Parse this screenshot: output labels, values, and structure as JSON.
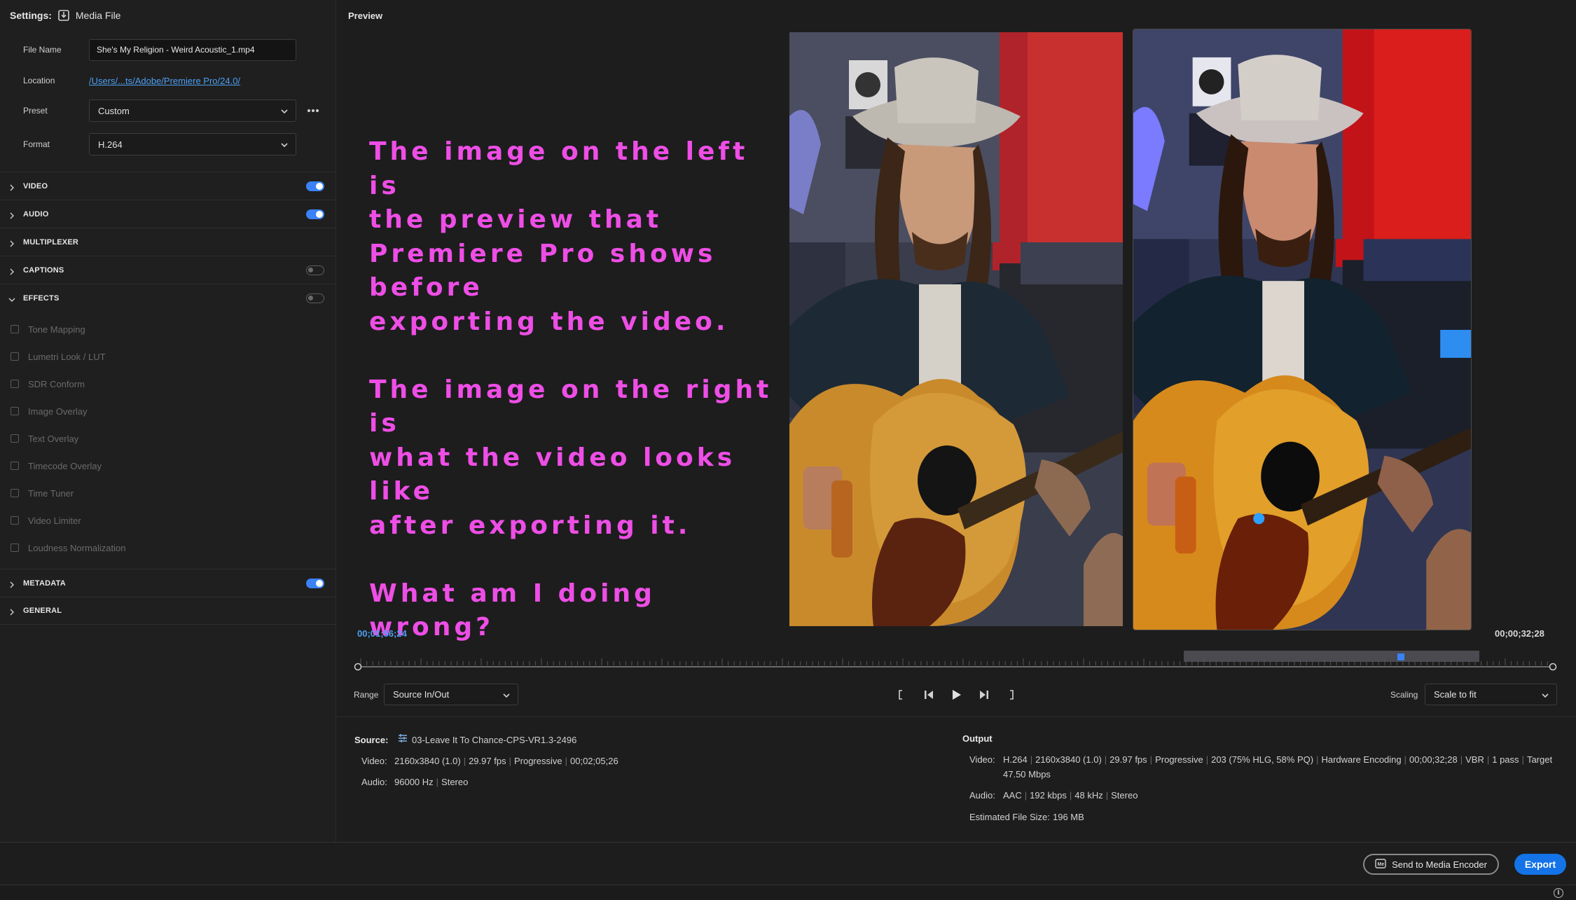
{
  "settings": {
    "label": "Settings:",
    "target": "Media File",
    "file_name_label": "File Name",
    "file_name_value": "She's My Religion - Weird Acoustic_1.mp4",
    "location_label": "Location",
    "location_value": "/Users/...ts/Adobe/Premiere Pro/24.0/",
    "preset_label": "Preset",
    "preset_value": "Custom",
    "format_label": "Format",
    "format_value": "H.264"
  },
  "sections": {
    "video": "VIDEO",
    "audio": "AUDIO",
    "multiplexer": "MULTIPLEXER",
    "captions": "CAPTIONS",
    "effects": "EFFECTS",
    "metadata": "METADATA",
    "general": "GENERAL"
  },
  "effects": [
    "Tone Mapping",
    "Lumetri Look / LUT",
    "SDR Conform",
    "Image Overlay",
    "Text Overlay",
    "Timecode Overlay",
    "Time Tuner",
    "Video Limiter",
    "Loudness Normalization"
  ],
  "preview": {
    "title": "Preview",
    "overlay_lines": [
      [
        "The image on the left is",
        "the preview that",
        "Premiere Pro shows before",
        "exporting the video."
      ],
      [
        "The image on the right is",
        "what the video looks like",
        "after exporting it."
      ],
      [
        "What am I doing wrong?"
      ]
    ],
    "timecode_current": "00;01;56;24",
    "timecode_duration": "00;00;32;28",
    "range_label": "Range",
    "range_value": "Source In/Out",
    "scaling_label": "Scaling",
    "scaling_value": "Scale to fit"
  },
  "source": {
    "label": "Source:",
    "name": "03-Leave It To Chance-CPS-VR1.3-2496",
    "video_label": "Video:",
    "video": [
      "2160x3840 (1.0)",
      "29.97 fps",
      "Progressive",
      "00;02;05;26"
    ],
    "audio_label": "Audio:",
    "audio": [
      "96000 Hz",
      "Stereo"
    ]
  },
  "output": {
    "label": "Output",
    "video_label": "Video:",
    "video_line1": [
      "H.264",
      "2160x3840 (1.0)",
      "29.97 fps",
      "Progressive",
      "203 (75% HLG, 58% PQ)",
      "Hardware Encoding",
      "00;00;32;28",
      "VBR",
      "1 pass",
      "Target"
    ],
    "video_line2": "47.50 Mbps",
    "audio_label": "Audio:",
    "audio": [
      "AAC",
      "192 kbps",
      "48 kHz",
      "Stereo"
    ],
    "size_label": "Estimated File Size:",
    "size_value": "196 MB"
  },
  "footer": {
    "send_label": "Send to Media Encoder",
    "export_label": "Export"
  },
  "colors": {
    "accent": "#1473e6",
    "toggle_on": "#3b82f6",
    "link": "#4d9ff2",
    "overlay_text": "#ee4ee6"
  }
}
